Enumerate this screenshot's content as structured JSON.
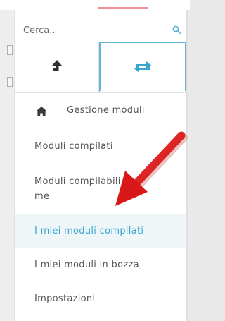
{
  "search": {
    "placeholder": "Cerca..",
    "icon": "search-icon"
  },
  "tabs": [
    {
      "icon": "upload-icon"
    },
    {
      "icon": "sync-icon",
      "active": true
    }
  ],
  "menu": {
    "items": [
      {
        "label": "Gestione moduli",
        "icon": "home-icon"
      },
      {
        "label": "Moduli compilati"
      },
      {
        "label": "Moduli compilabili da me"
      },
      {
        "label": "I miei moduli compilati",
        "active": true
      },
      {
        "label": "I miei moduli in bozza"
      },
      {
        "label": "Impostazioni"
      }
    ]
  },
  "colors": {
    "accent": "#3aa6cf",
    "active_bg": "#eef6f8",
    "arrow": "#e41c1c"
  }
}
